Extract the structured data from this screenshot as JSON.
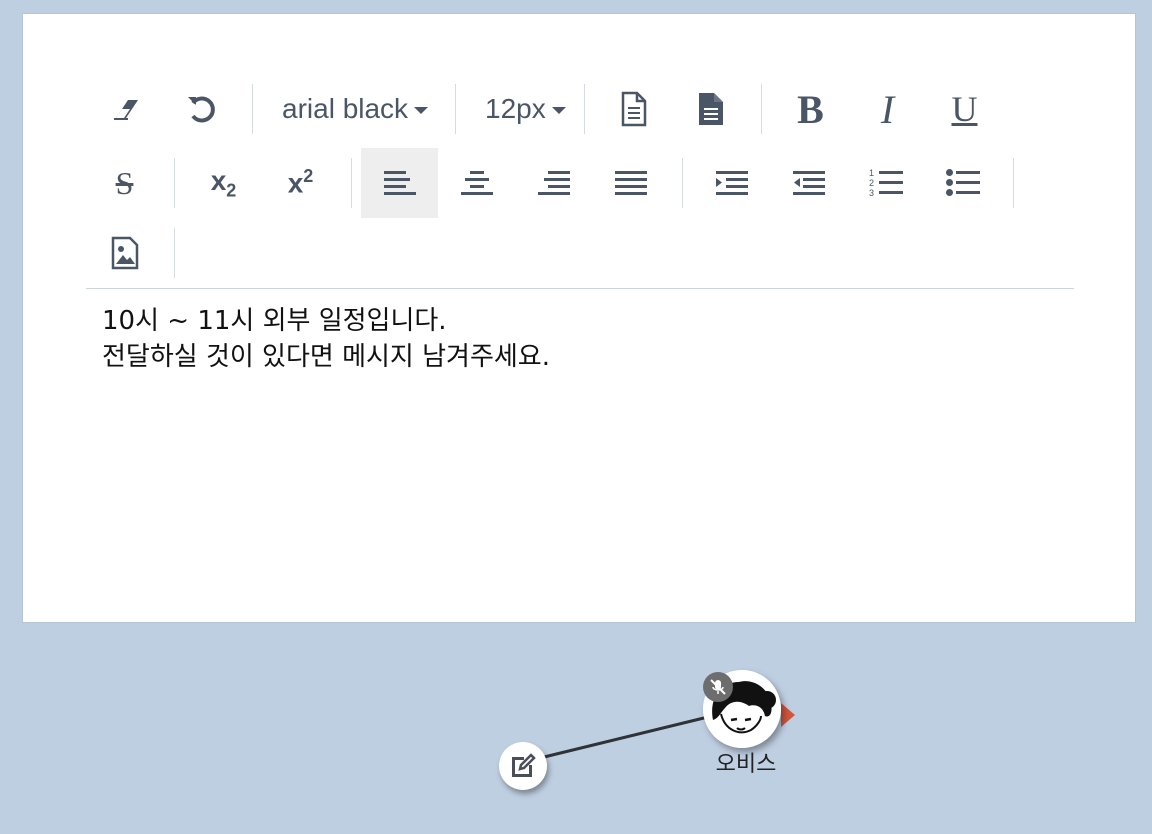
{
  "toolbar": {
    "font_family": "arial black",
    "font_size": "12px",
    "bold_label": "B",
    "italic_label": "I",
    "underline_label": "U",
    "strike_label": "S",
    "subscript_label": "x",
    "subscript_mark": "2",
    "superscript_label": "x",
    "superscript_mark": "2",
    "active_alignment": "align-left",
    "icons": [
      "eraser-icon",
      "undo-icon",
      "document-outline-icon",
      "document-filled-icon",
      "align-left-icon",
      "align-center-icon",
      "align-right-icon",
      "align-justify-icon",
      "indent-icon",
      "outdent-icon",
      "ordered-list-icon",
      "unordered-list-icon",
      "image-icon"
    ]
  },
  "content": {
    "lines": [
      "10시 ~ 11시 외부 일정입니다.",
      "전달하실 것이 있다면 메시지 남겨주세요."
    ]
  },
  "widget": {
    "name": "오비스",
    "pointer_color": "#d1563c",
    "icons": [
      "edit-icon",
      "mute-icon",
      "avatar"
    ]
  },
  "colors": {
    "background": "#bfcfe2",
    "icon": "#4a5666",
    "active_button": "#eeeeee"
  }
}
